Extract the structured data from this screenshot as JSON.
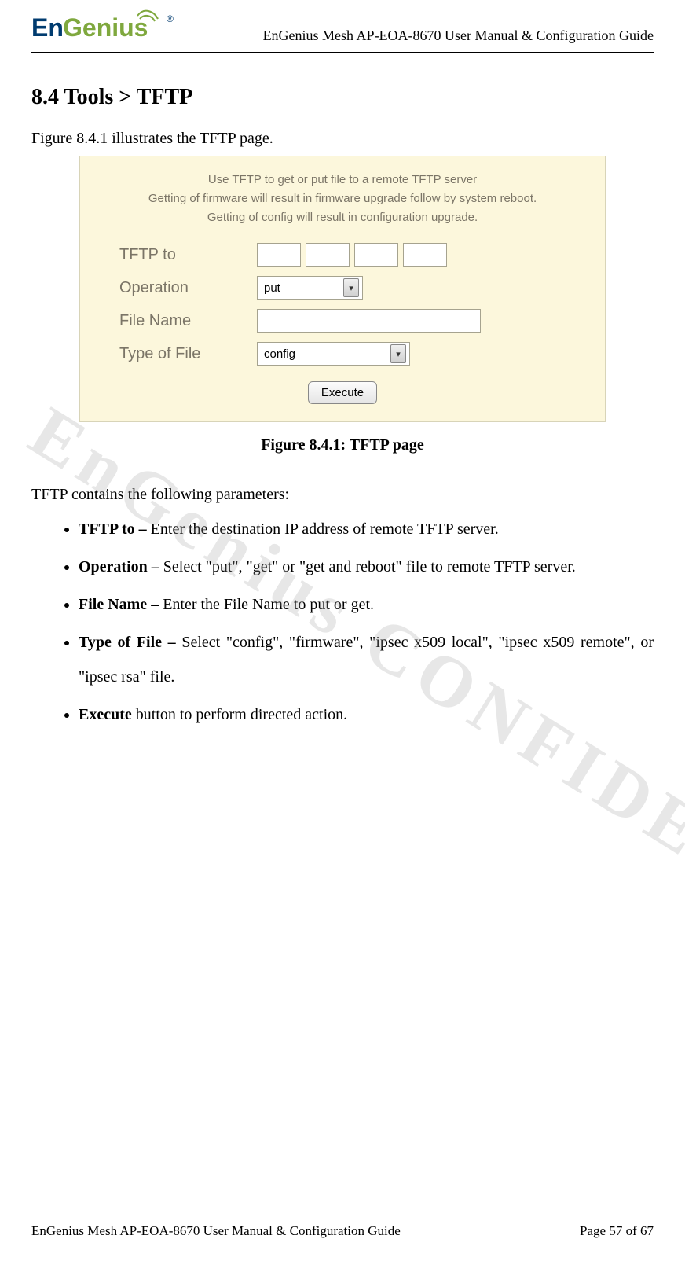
{
  "header": {
    "logo_text": "EnGenius",
    "doc_title": "EnGenius Mesh AP-EOA-8670 User Manual & Configuration Guide"
  },
  "section": {
    "heading": "8.4    Tools > TFTP",
    "intro": "Figure 8.4.1 illustrates the TFTP page."
  },
  "screenshot": {
    "desc_line1": "Use TFTP to get or put file to a remote TFTP server",
    "desc_line2": "Getting of firmware will result in firmware upgrade follow by system reboot.",
    "desc_line3": "Getting of config will result in configuration upgrade.",
    "labels": {
      "tftp_to": "TFTP to",
      "operation": "Operation",
      "file_name": "File Name",
      "type_of_file": "Type of File"
    },
    "values": {
      "operation": "put",
      "type_of_file": "config",
      "file_name": ""
    },
    "execute_button": "Execute"
  },
  "figure_caption": "Figure 8.4.1: TFTP page",
  "params_intro": "TFTP contains the following parameters:",
  "params": [
    {
      "label": "TFTP to – ",
      "desc": "Enter the destination IP address of remote TFTP server."
    },
    {
      "label": "Operation – ",
      "desc": "Select \"put\", \"get\" or \"get and reboot\" file to remote TFTP server."
    },
    {
      "label": "File Name – ",
      "desc": "Enter the File Name to put or get."
    },
    {
      "label": "Type of File – ",
      "desc": "Select \"config\", \"firmware\", \"ipsec x509 local\", \"ipsec x509 remote\", or \"ipsec rsa\" file."
    },
    {
      "label": "Execute",
      "desc": " button to perform directed action."
    }
  ],
  "watermark": "EnGenius CONFIDENTIAL",
  "footer": {
    "left": "EnGenius Mesh AP-EOA-8670 User Manual & Configuration Guide",
    "right": "Page 57 of 67"
  }
}
